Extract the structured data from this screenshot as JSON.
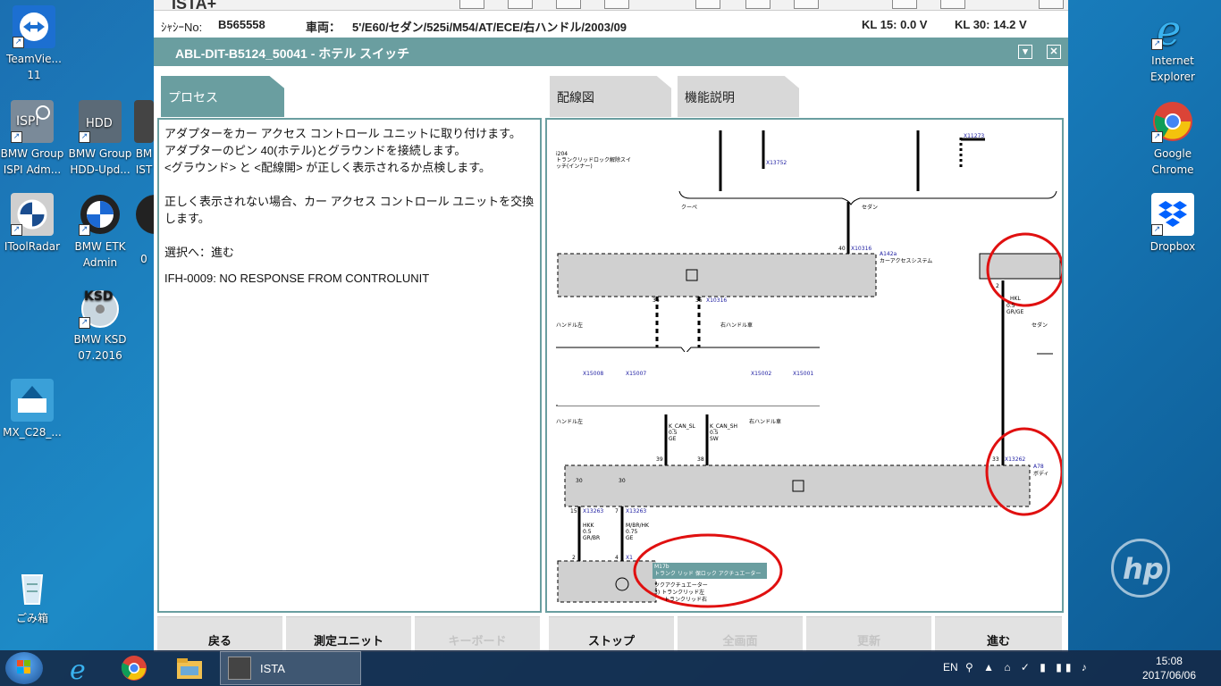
{
  "desktop_icons_left": [
    {
      "label": "TeamVie...\n11",
      "icon": "teamviewer-icon"
    },
    {
      "label": "BMW Group\nISPI Adm...",
      "icon": "ispi-admin-icon"
    },
    {
      "label": "BMW Group\nHDD-Upd...",
      "icon": "hdd-update-icon"
    },
    {
      "label": "BM\nIST",
      "icon": "bmw-ista-icon"
    },
    {
      "label": "IToolRadar",
      "icon": "itoolradar-icon"
    },
    {
      "label": "BMW ETK\nAdmin",
      "icon": "bmw-etk-icon"
    },
    {
      "label": "0",
      "icon": "bmw-icon"
    },
    {
      "label": "BMW KSD\n07.2016",
      "icon": "ksd-icon"
    },
    {
      "label": "MX_C28_...",
      "icon": "mx-c28-icon"
    },
    {
      "label": "ごみ箱",
      "icon": "recycle-bin-icon"
    }
  ],
  "desktop_icons_right": [
    {
      "label": "Internet\nExplorer",
      "icon": "internet-explorer-icon"
    },
    {
      "label": "Google\nChrome",
      "icon": "chrome-icon"
    },
    {
      "label": "Dropbox",
      "icon": "dropbox-icon"
    }
  ],
  "window": {
    "app_title": "ISTA+",
    "vehicle": {
      "chassis_label": "ｼｬｼｰNo:",
      "chassis_value": "B565558",
      "vehicle_label": "車両：",
      "vehicle_value": "5'/E60/セダン/525i/M54/AT/ECE/右ハンドル/2003/09",
      "kl15": "KL 15:  0.0 V",
      "kl30": "KL 30:  14.2 V"
    },
    "title": "ABL-DIT-B5124_50041 - ホテル スイッチ",
    "tabs": {
      "process": "プロセス",
      "wiring": "配線図",
      "function": "機能説明"
    },
    "process_text": {
      "p1": "アダプターをカー アクセス コントロール ユニットに取り付けます。\nアダプターのピン 40(ホテル)とグラウンドを接続します。\n<グラウンド> と <配線開> が正しく表示されるか点検します。",
      "p2": "正しく表示されない場合、カー アクセス コントロール ユニットを交換します。",
      "p3": "選択へ：進む",
      "p4": "IFH-0009: NO RESPONSE FROM CONTROLUNIT"
    },
    "wiring": {
      "l_kombi": "i204\nトランクリッドロック解除スイ\nッチ(インナー)",
      "x13752": "X13752",
      "x11273": "X11273",
      "coupe": "クーペ",
      "sedan": "セダン",
      "pin40": "40",
      "x10316a": "X10316",
      "a142a": "A142a",
      "car_access": "カーアクセスシステム",
      "pin2": "2",
      "hkl": "HKL",
      "hkl_wire": "0.5\nGR/GE",
      "sedan2": "セダン",
      "pin36": "36",
      "pin35": "35",
      "x10316b": "X10316",
      "handle_left": "ハンドル左",
      "handle_right": "右ハンドル車",
      "x15008": "X15008",
      "x15007": "X15007",
      "x15002": "X15002",
      "x15001": "X15001",
      "handle_left2": "ハンドル左",
      "kcan_sl": "K_CAN_SL\n0.5\nGE",
      "kcan_sh": "K_CAN_SH\n0.5\nSW",
      "handle_right2": "右ハンドル車",
      "pin39": "39",
      "pin38": "38",
      "pin33": "33",
      "x13262": "X13262",
      "a78": "A78",
      "body": "ボディ",
      "pin30a": "30",
      "pin30b": "30",
      "pin15": "15",
      "x13263a": "X13263",
      "pin7": "7",
      "x13263b": "X13263",
      "hkk": "HKK\n0.5\nGR/BR",
      "hkk2": "M/BR/HK\n0.75\nGE",
      "pin2b": "2",
      "pin4": "4",
      "x1": "X1",
      "m17b": "M17b",
      "actuator": "トランク リッド 保ロック アクチュエーター",
      "actuator2": "ツクアクチュエーター",
      "sub1": "3)  トランクリッド左",
      "sub2": "トランクリッド右"
    },
    "buttons": [
      {
        "label": "戻る",
        "disabled": false
      },
      {
        "label": "測定ユニット",
        "disabled": false
      },
      {
        "label": "キーボード",
        "disabled": true
      },
      {
        "label": "ストップ",
        "disabled": false
      },
      {
        "label": "全画面",
        "disabled": true
      },
      {
        "label": "更新",
        "disabled": true
      },
      {
        "label": "進む",
        "disabled": false
      }
    ]
  },
  "taskbar": {
    "ista_label": "ISTA",
    "lang": "EN",
    "time": "15:08",
    "date": "2017/06/06"
  },
  "colors": {
    "teal": "#6a9ea0",
    "annotation_red": "#e01010",
    "block_gray": "#d0d0d0"
  }
}
